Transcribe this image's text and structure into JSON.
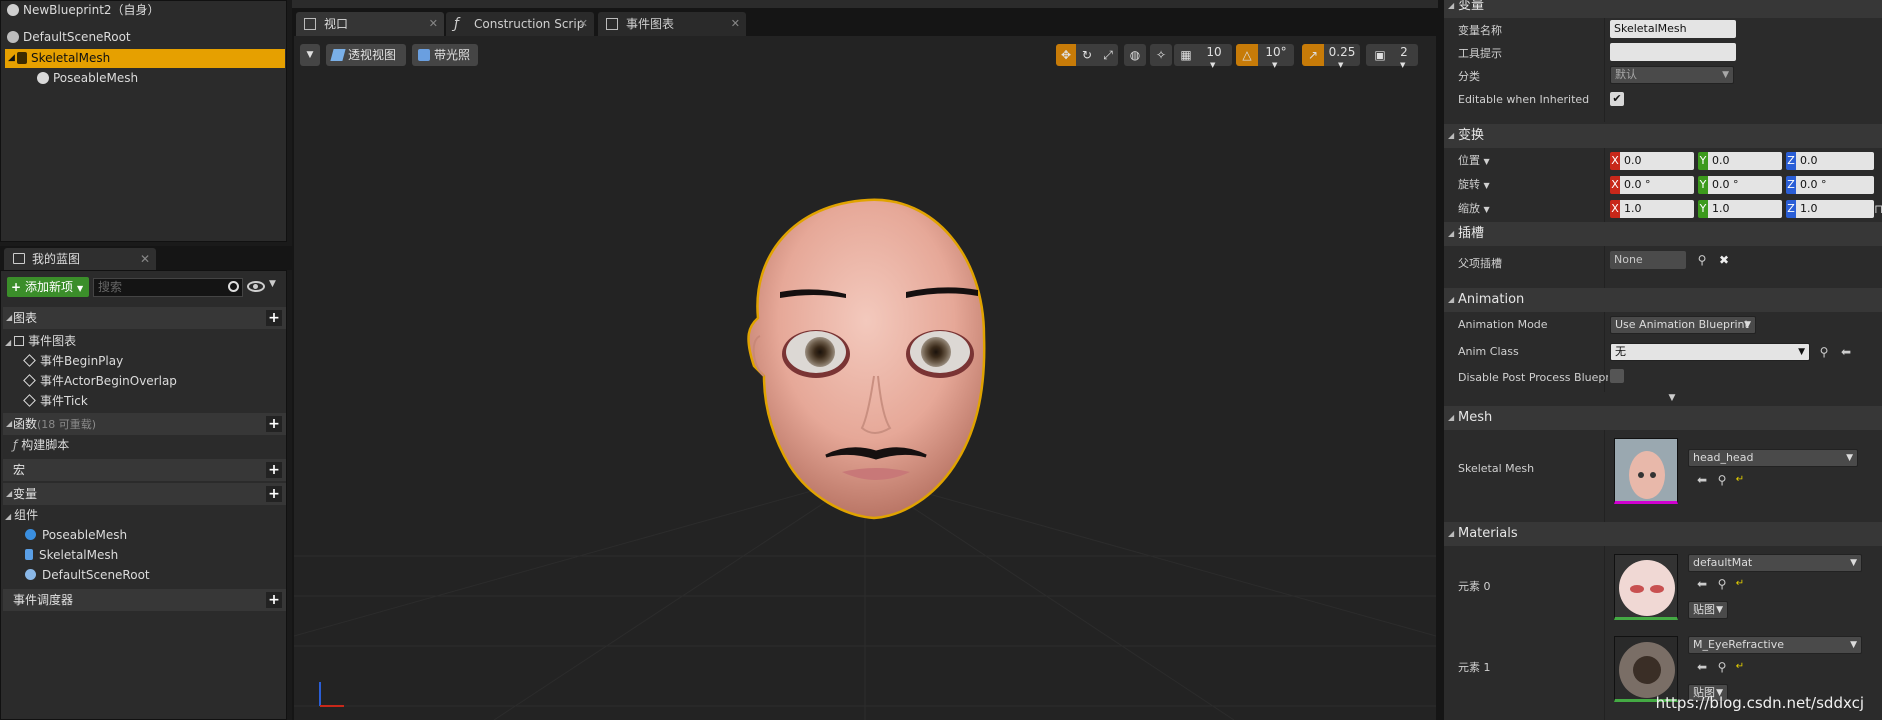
{
  "components": {
    "root_item": "NewBlueprint2（自身）",
    "items": [
      "DefaultSceneRoot",
      "SkeletalMesh",
      "PoseableMesh"
    ]
  },
  "my_blueprint": {
    "tab": "我的蓝图",
    "add_new": "添加新项",
    "search_placeholder": "搜索",
    "graphs": "图表",
    "event_graph": "事件图表",
    "events": [
      "事件BeginPlay",
      "事件ActorBeginOverlap",
      "事件Tick"
    ],
    "functions": "函数",
    "functions_sub": "(18 可重载)",
    "construction_script": "构建脚本",
    "macros": "宏",
    "variables": "变量",
    "components_label": "组件",
    "component_items": [
      "PoseableMesh",
      "SkeletalMesh",
      "DefaultSceneRoot"
    ],
    "event_dispatchers": "事件调度器"
  },
  "viewport": {
    "tabs": [
      "视口",
      "Construction Scrip",
      "事件图表"
    ],
    "perspective": "透视视图",
    "lit": "带光照",
    "grid_snap": "10",
    "rot_snap": "10°",
    "scale_snap": "0.25",
    "camera_speed": "2"
  },
  "details": {
    "variable_section": "变量",
    "var_name_label": "变量名称",
    "var_name_value": "SkeletalMesh",
    "tooltip_label": "工具提示",
    "category_label": "分类",
    "category_value": "默认",
    "editable_label": "Editable when Inherited",
    "transform_section": "变换",
    "location_label": "位置",
    "rotation_label": "旋转",
    "scale_label": "缩放",
    "loc": [
      "0.0",
      "0.0",
      "0.0"
    ],
    "rot": [
      "0.0 °",
      "0.0 °",
      "0.0 °"
    ],
    "scl": [
      "1.0",
      "1.0",
      "1.0"
    ],
    "axis_letters": [
      "X",
      "Y",
      "Z"
    ],
    "sockets_section": "插槽",
    "parent_socket_label": "父项插槽",
    "parent_socket_value": "None",
    "animation_section": "Animation",
    "anim_mode_label": "Animation Mode",
    "anim_mode_value": "Use Animation Blueprint",
    "anim_class_label": "Anim Class",
    "anim_class_value": "无",
    "disable_pp_label": "Disable Post Process Bluepri",
    "mesh_section": "Mesh",
    "skeletal_mesh_label": "Skeletal Mesh",
    "skeletal_mesh_value": "head_head",
    "materials_section": "Materials",
    "element0_label": "元素 0",
    "element0_value": "defaultMat",
    "element1_label": "元素 1",
    "element1_value": "M_EyeRefractive",
    "texture_btn": "贴图"
  },
  "watermark": "https://blog.csdn.net/sddxcj"
}
